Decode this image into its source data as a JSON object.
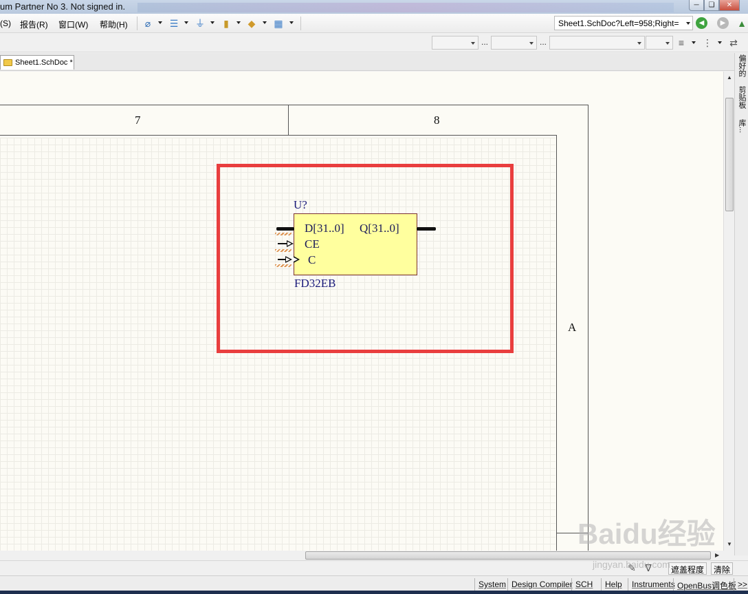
{
  "titlebar": {
    "title": "um Partner No 3. Not signed in."
  },
  "menu": {
    "items": [
      "(S)",
      "报告(R)",
      "窗口(W)",
      "帮助(H)"
    ],
    "address": "Sheet1.SchDoc?Left=958;Right="
  },
  "tabs": {
    "doc_tab": "Sheet1.SchDoc *"
  },
  "side_panel": {
    "tabs": [
      "偏好的",
      "剪贴板",
      "库..."
    ]
  },
  "sheet": {
    "zone_cols": [
      "7",
      "8"
    ],
    "zone_row": "A"
  },
  "component": {
    "designator": "U?",
    "pins_left": [
      "D[31..0]",
      "CE",
      "C"
    ],
    "pins_right": [
      "Q[31..0]"
    ],
    "type": "FD32EB"
  },
  "lowbar": {
    "mask_label": "遮盖程度",
    "clear_label": "清除"
  },
  "statusbar": {
    "buttons": [
      "System",
      "Design Compiler",
      "SCH",
      "Help",
      "Instruments",
      "OpenBus调色板",
      ">>"
    ]
  },
  "watermark": {
    "text": "Baidu经验",
    "sub": "jingyan.baidu.com"
  },
  "colors": {
    "highlight": "#e93e3e",
    "component_fill": "#ffff9e",
    "designator": "#1a1a7a"
  }
}
